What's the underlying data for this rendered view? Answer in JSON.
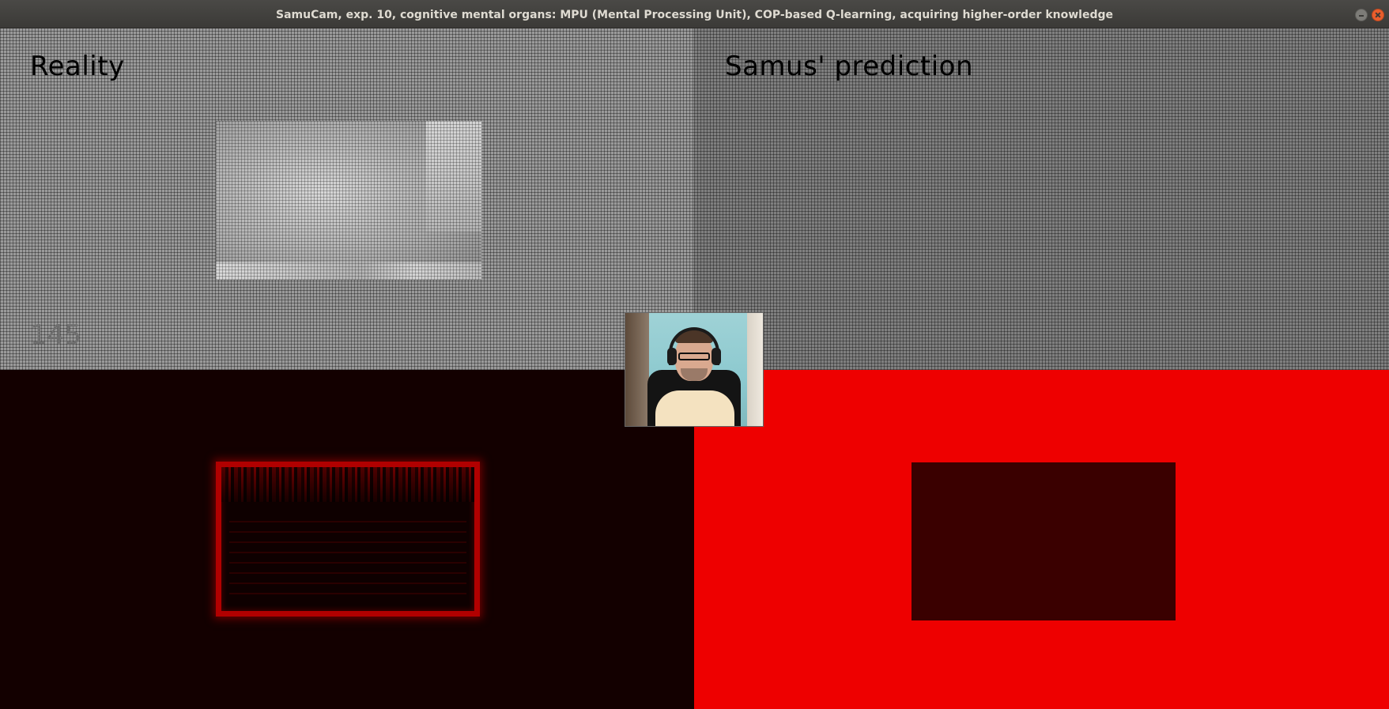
{
  "window": {
    "title": "SamuCam, exp. 10, cognitive mental organs: MPU (Mental Processing Unit), COP-based Q-learning, acquiring higher-order knowledge"
  },
  "reality": {
    "title": "Reality",
    "counter": "145"
  },
  "prediction": {
    "title": "Samus' prediction"
  },
  "colors": {
    "prediction_background": "#ee0000",
    "prediction_rect": "#3a0000",
    "difference_background": "#130000",
    "difference_frame": "#b10000"
  },
  "icons": {
    "minimize": "minimize-icon",
    "close": "close-icon"
  }
}
